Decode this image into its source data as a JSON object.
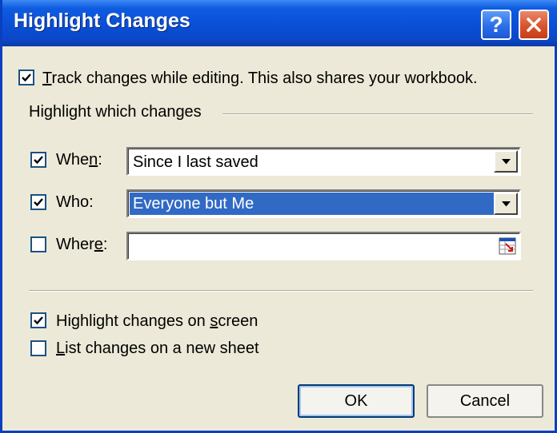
{
  "window": {
    "title": "Highlight Changes"
  },
  "titlebar_buttons": {
    "help": "?"
  },
  "track_changes": {
    "checked": true,
    "label_prefix": "",
    "label_mnemonic": "T",
    "label_rest": "rack changes while editing. This also shares your workbook."
  },
  "group": {
    "title": "Highlight which changes"
  },
  "when": {
    "checked": true,
    "label_pre": "Whe",
    "label_mnemonic": "n",
    "label_post": ":",
    "value": "Since I last saved"
  },
  "who": {
    "checked": true,
    "label_pre": "Who",
    "label_mnemonic": "",
    "label_post": ":",
    "value": "Everyone but Me"
  },
  "where": {
    "checked": false,
    "label_pre": "Wher",
    "label_mnemonic": "e",
    "label_post": ":",
    "value": ""
  },
  "highlight_on_screen": {
    "checked": true,
    "label_pre": "Highlight changes on ",
    "label_mnemonic": "s",
    "label_post": "creen"
  },
  "list_changes": {
    "checked": false,
    "label_pre": "",
    "label_mnemonic": "L",
    "label_post": "ist changes on a new sheet"
  },
  "buttons": {
    "ok": "OK",
    "cancel": "Cancel"
  },
  "colors": {
    "titlebar": "#0a4fd6",
    "selection": "#316ac5",
    "dialog_bg": "#ece9d8",
    "close_button": "#d8532d"
  }
}
